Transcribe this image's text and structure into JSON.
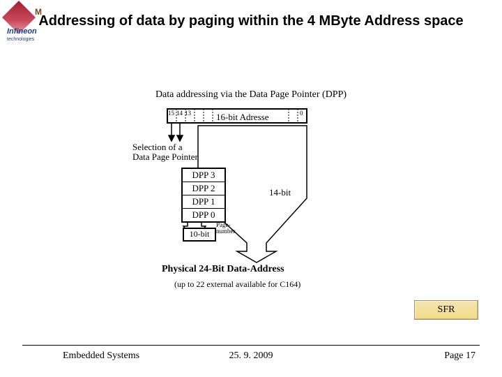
{
  "logo": {
    "brand": "Infineon",
    "sub": "technologies",
    "letter": "M"
  },
  "title": "Addressing of data by paging within the 4 MByte Address space",
  "subtitle": "Data addressing via the Data Page Pointer (DPP)",
  "topbox": {
    "bit15": "15",
    "bit14": "14",
    "bit13": "13",
    "label": "16-bit Adresse",
    "bit0": "0"
  },
  "selection": {
    "line1": "Selection of a",
    "line2": "Data Page Pointer"
  },
  "dpp": {
    "r3": "DPP 3",
    "r2": "DPP 2",
    "r1": "DPP 1",
    "r0": "DPP 0"
  },
  "bits14": "14-bit",
  "tenbit": "10-bit",
  "pagenum": {
    "l1": "Page-",
    "l2": "number"
  },
  "phys": "Physical 24-Bit Data-Address",
  "phys_note": "(up to 22 external available for C164)",
  "sfr": "SFR",
  "footer": {
    "left": "Embedded Systems",
    "center": "25. 9. 2009",
    "right": "Page 17"
  }
}
